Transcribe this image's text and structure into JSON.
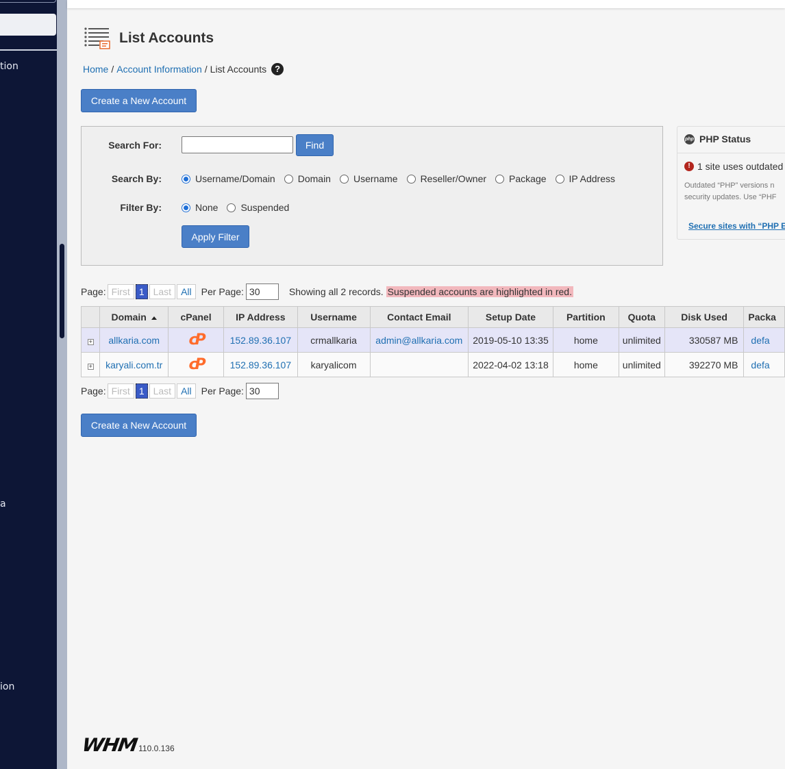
{
  "sidebar": {
    "items": [
      {
        "label": "tion"
      },
      {
        "label": "a"
      },
      {
        "label": "ion"
      }
    ]
  },
  "header": {
    "title": "List Accounts"
  },
  "breadcrumb": {
    "home": "Home",
    "sep": "/",
    "section": "Account Information",
    "current": "List Accounts",
    "help": "?"
  },
  "actions": {
    "create_label": "Create a New Account"
  },
  "search": {
    "search_for_label": "Search For:",
    "search_value": "",
    "find_label": "Find",
    "search_by_label": "Search By:",
    "search_by_options": [
      "Username/Domain",
      "Domain",
      "Username",
      "Reseller/Owner",
      "Package",
      "IP Address"
    ],
    "search_by_selected": "Username/Domain",
    "filter_by_label": "Filter By:",
    "filter_options": [
      "None",
      "Suspended"
    ],
    "filter_selected": "None",
    "apply_label": "Apply Filter"
  },
  "php_status": {
    "title": "PHP Status",
    "logo_text": "php",
    "alert": "1 site uses outdated",
    "desc_line1": "Outdated “PHP” versions n",
    "desc_line2": "security updates. Use “PHF",
    "link": "Secure sites with “PHP El"
  },
  "pager": {
    "page_label": "Page:",
    "first": "First",
    "current": "1",
    "last": "Last",
    "all": "All",
    "per_page_label": "Per Page:",
    "per_page_value": "30",
    "showing": "Showing all 2 records.",
    "suspended_note": "Suspended accounts are highlighted in red."
  },
  "table": {
    "columns": [
      "Domain",
      "cPanel",
      "IP Address",
      "Username",
      "Contact Email",
      "Setup Date",
      "Partition",
      "Quota",
      "Disk Used",
      "Packa"
    ],
    "rows": [
      {
        "expand": "+",
        "domain": "allkaria.com",
        "ip": "152.89.36.107",
        "username": "crmallkaria",
        "email": "admin@allkaria.com",
        "setup_date": "2019-05-10 13:35",
        "partition": "home",
        "quota": "unlimited",
        "disk_used": "330587 MB",
        "package": "defa"
      },
      {
        "expand": "+",
        "domain": "karyali.com.tr",
        "ip": "152.89.36.107",
        "username": "karyalicom",
        "email": "",
        "setup_date": "2022-04-02 13:18",
        "partition": "home",
        "quota": "unlimited",
        "disk_used": "392270 MB",
        "package": "defa"
      }
    ]
  },
  "footer": {
    "logo": "WHM",
    "version": "110.0.136"
  },
  "colors": {
    "sidebar_bg": "#0d1636",
    "accent": "#4a7fc7",
    "link": "#1f6fb2",
    "highlight_row": "#e5e5f8",
    "suspended_highlight": "#f2b8bd",
    "cpanel_orange": "#ff6c2c"
  }
}
